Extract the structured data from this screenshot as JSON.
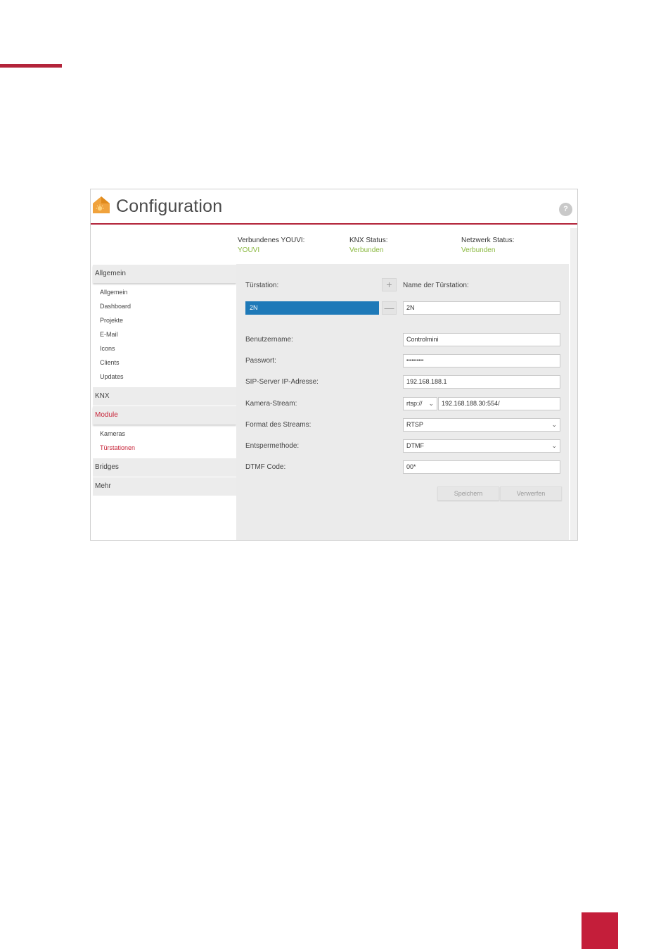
{
  "app": {
    "title": "Configuration",
    "help_glyph": "?",
    "logo_icon": "house-sun-logo-icon",
    "accent_color": "#b3243a",
    "status_ok_color": "#8ab83f",
    "selection_color": "#1e79b8"
  },
  "status": [
    {
      "label": "Verbundenes YOUVI:",
      "value": "YOUVI"
    },
    {
      "label": "KNX Status:",
      "value": "Verbunden"
    },
    {
      "label": "Netzwerk Status:",
      "value": "Verbunden"
    }
  ],
  "sidebar": {
    "groups": {
      "allgemein": "Allgemein",
      "knx": "KNX",
      "module": "Module",
      "bridges": "Bridges",
      "mehr": "Mehr"
    },
    "allgemein_items": [
      "Allgemein",
      "Dashboard",
      "Projekte",
      "E-Mail",
      "Icons",
      "Clients",
      "Updates"
    ],
    "module_items": [
      "Kameras",
      "Türstationen"
    ],
    "active_group": "Module",
    "active_item": "Türstationen"
  },
  "form": {
    "station_label": "Türstation:",
    "station_name_label": "Name der Türstation:",
    "stations": [
      "2N"
    ],
    "add_glyph": "+",
    "remove_glyph": "—",
    "station_name_value": "2N",
    "username_label": "Benutzername:",
    "username_value": "Controlmini",
    "password_label": "Passwort:",
    "password_value": "••••••••••",
    "sip_label": "SIP-Server IP-Adresse:",
    "sip_value": "192.168.188.1",
    "camera_label": "Kamera-Stream:",
    "camera_protocol": "rtsp://",
    "camera_value": "192.168.188.30:554/",
    "format_label": "Format des Streams:",
    "format_value": "RTSP",
    "unlock_label": "Entspermethode:",
    "unlock_value": "DTMF",
    "dtmf_label": "DTMF Code:",
    "dtmf_value": "00*",
    "save_label": "Speichern",
    "discard_label": "Verwerfen",
    "chevron_glyph": "⌄"
  }
}
